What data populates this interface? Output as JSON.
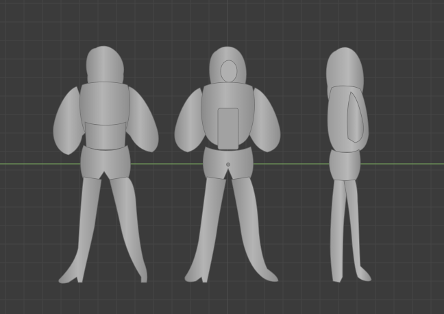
{
  "viewport": {
    "mode": "orthographic-front-side-back",
    "colors": {
      "background": "#3b3b3b",
      "grid_minor": "#464646",
      "grid_major": "#4f4f4f",
      "x_axis": "#6f9a5a",
      "model": "#a8a8a8",
      "model_shadow": "#7a7a7a"
    },
    "objects": [
      {
        "id": "back-view",
        "label": ""
      },
      {
        "id": "front-view",
        "label": ""
      },
      {
        "id": "side-view",
        "label": ""
      }
    ]
  }
}
